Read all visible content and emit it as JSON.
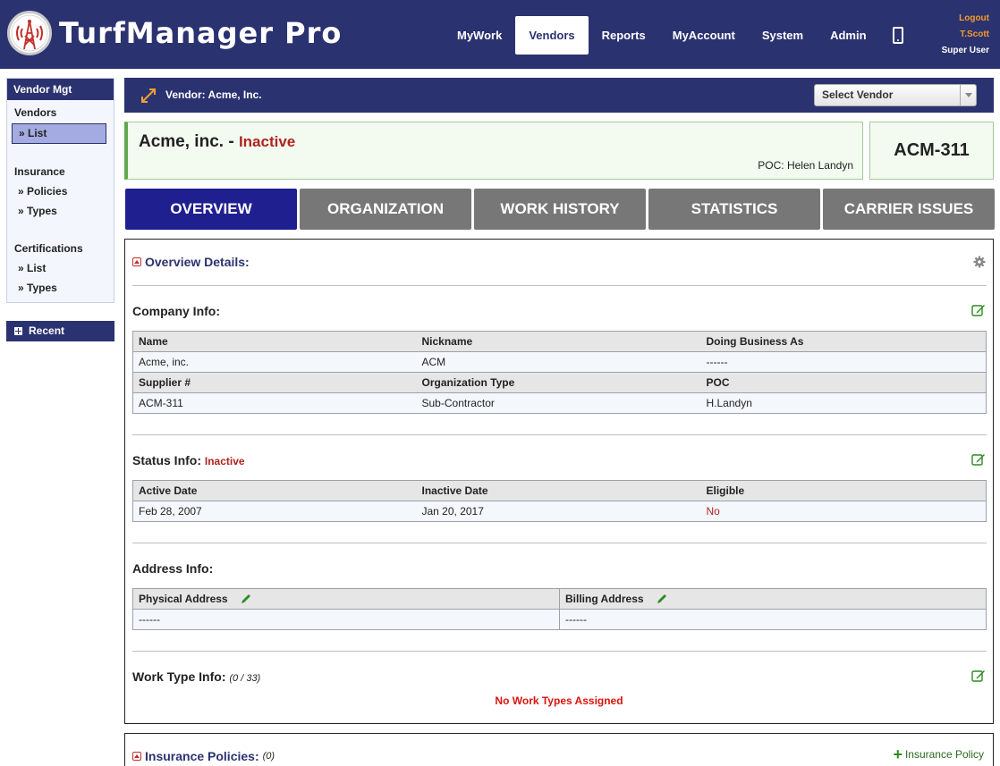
{
  "header": {
    "logo_text": "TurfManager Pro",
    "nav": [
      "MyWork",
      "Vendors",
      "Reports",
      "MyAccount",
      "System",
      "Admin"
    ],
    "active_nav": "Vendors",
    "logout": "Logout",
    "user": "T.Scott",
    "role": "Super User"
  },
  "sidebar": {
    "title": "Vendor Mgt",
    "groups": [
      {
        "label": "Vendors",
        "links": [
          "» List"
        ]
      },
      {
        "label": "Insurance",
        "links": [
          "» Policies",
          "» Types"
        ]
      },
      {
        "label": "Certifications",
        "links": [
          "» List",
          "» Types"
        ]
      }
    ],
    "recent": "Recent"
  },
  "vendor_bar": {
    "title": "Vendor: Acme, Inc.",
    "select_placeholder": "Select Vendor"
  },
  "vendor": {
    "name": "Acme, inc. -",
    "status": "Inactive",
    "poc": "POC: Helen Landyn",
    "id": "ACM-311"
  },
  "tabs": [
    "OVERVIEW",
    "ORGANIZATION",
    "WORK HISTORY",
    "STATISTICS",
    "CARRIER ISSUES"
  ],
  "overview": {
    "title": "Overview Details:",
    "company": {
      "title": "Company Info:",
      "headers1": [
        "Name",
        "Nickname",
        "Doing Business As"
      ],
      "row1": [
        "Acme, inc.",
        "ACM",
        "------"
      ],
      "headers2": [
        "Supplier #",
        "Organization Type",
        "POC"
      ],
      "row2": [
        "ACM-311",
        "Sub-Contractor",
        "H.Landyn"
      ]
    },
    "status": {
      "title": "Status Info:",
      "value": "Inactive",
      "headers": [
        "Active Date",
        "Inactive Date",
        "Eligible"
      ],
      "row": [
        "Feb 28, 2007",
        "Jan 20, 2017",
        "No"
      ]
    },
    "address": {
      "title": "Address Info:",
      "headers": [
        "Physical Address",
        "Billing Address"
      ],
      "row": [
        "------",
        "------"
      ]
    },
    "work_type": {
      "title": "Work Type Info:",
      "count": "(0 / 33)",
      "empty": "No Work Types Assigned"
    }
  },
  "insurance": {
    "title": "Insurance Policies:",
    "count": "(0)",
    "add_label": "Insurance Policy"
  },
  "colors": {
    "navy": "#2b3270",
    "active_tab": "#1f1f8f",
    "inactive_red": "#b0231f",
    "edit_green": "#2f8a23"
  }
}
